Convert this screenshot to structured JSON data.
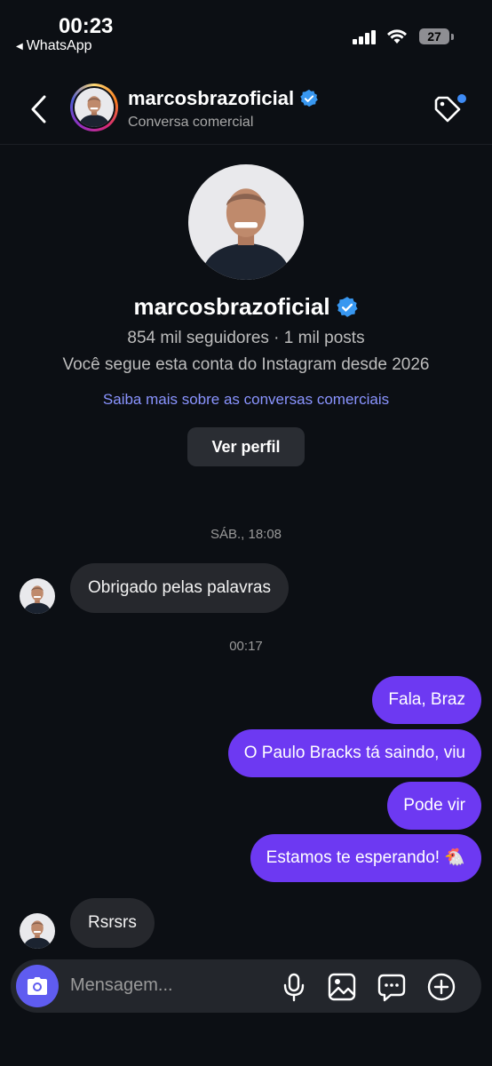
{
  "status_bar": {
    "time": "00:23",
    "back_app": "WhatsApp",
    "battery": "27"
  },
  "header": {
    "name": "marcosbrazoficial",
    "subtitle": "Conversa comercial"
  },
  "profile": {
    "name": "marcosbrazoficial",
    "stats": "854 mil seguidores · 1 mil posts",
    "follow_since": "Você segue esta conta do Instagram desde 2026",
    "link": "Saiba mais sobre as conversas comerciais",
    "button": "Ver perfil"
  },
  "chat": {
    "timestamp_1": "SÁB., 18:08",
    "msg_in_1": "Obrigado pelas palavras",
    "timestamp_2": "00:17",
    "msg_out_1": "Fala, Braz",
    "msg_out_2": "O Paulo Bracks tá saindo, viu",
    "msg_out_3": "Pode vir",
    "msg_out_4": "Estamos te esperando! 🐔",
    "msg_in_2": "Rsrsrs"
  },
  "composer": {
    "placeholder": "Mensagem..."
  },
  "colors": {
    "background": "#0c0f14",
    "outgoing_bubble": "#6d39f2",
    "incoming_bubble": "#26282d",
    "verified": "#3897f0",
    "link": "#8a94ff",
    "camera_button": "#5f5cf0"
  }
}
